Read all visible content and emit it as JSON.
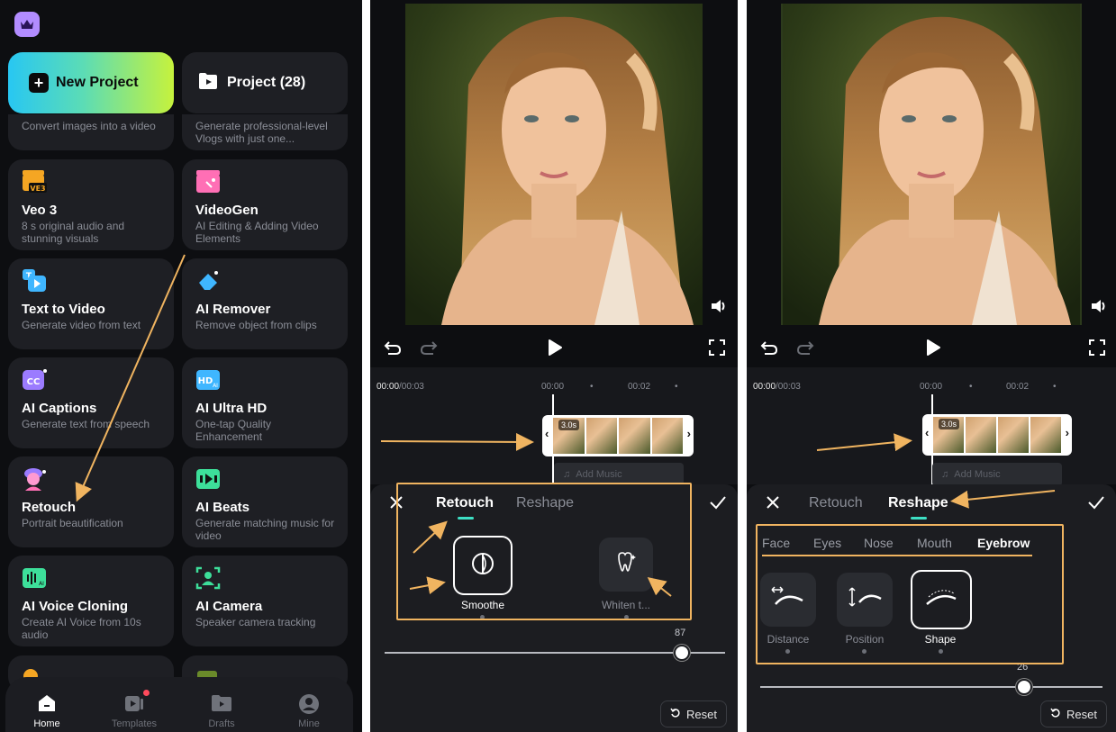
{
  "home": {
    "new_project_label": "New Project",
    "project_label": "Project (28)",
    "partial_cards": [
      {
        "desc": "Convert images into a video"
      },
      {
        "desc": "Generate professional-level Vlogs with just one..."
      }
    ],
    "cards": [
      {
        "title": "Veo 3",
        "desc": "8 s original audio and stunning visuals",
        "icon": "veo3-icon",
        "color": "#f5a623"
      },
      {
        "title": "VideoGen",
        "desc": "AI Editing & Adding Video Elements",
        "icon": "videogen-icon",
        "color": "#ff6fb5"
      },
      {
        "title": "Text to Video",
        "desc": "Generate video from text",
        "icon": "text-to-video-icon",
        "color": "#3fb6ff"
      },
      {
        "title": "AI Remover",
        "desc": "Remove object from clips",
        "icon": "eraser-icon",
        "color": "#3fb6ff"
      },
      {
        "title": "AI Captions",
        "desc": "Generate text from speech",
        "icon": "captions-icon",
        "color": "#9b7bff"
      },
      {
        "title": "AI Ultra HD",
        "desc": "One-tap Quality Enhancement",
        "icon": "hd-icon",
        "color": "#3fb6ff"
      },
      {
        "title": "Retouch",
        "desc": "Portrait beautification",
        "icon": "retouch-icon",
        "color": "#ff6fb5"
      },
      {
        "title": "AI Beats",
        "desc": "Generate matching music for video",
        "icon": "beats-icon",
        "color": "#3ddf9a"
      },
      {
        "title": "AI Voice Cloning",
        "desc": "Create AI Voice from 10s audio",
        "icon": "voice-cloning-icon",
        "color": "#3ddf9a"
      },
      {
        "title": "AI Camera",
        "desc": "Speaker camera tracking",
        "icon": "camera-icon",
        "color": "#3ddf9a"
      }
    ],
    "nav": [
      {
        "label": "Home",
        "icon": "home-icon"
      },
      {
        "label": "Templates",
        "icon": "templates-icon"
      },
      {
        "label": "Drafts",
        "icon": "drafts-icon"
      },
      {
        "label": "Mine",
        "icon": "profile-icon"
      }
    ]
  },
  "editor": {
    "time_current": "00:00",
    "time_total": "/00:03",
    "tick1": "00:00",
    "tick2": "00:02",
    "clip_duration": "3.0s",
    "add_music": "Add Music",
    "reset": "Reset"
  },
  "retouch": {
    "tabs": [
      "Retouch",
      "Reshape"
    ],
    "tools": [
      {
        "label": "Smoothe",
        "icon": "smooth-icon"
      },
      {
        "label": "Whiten t...",
        "icon": "tooth-icon"
      }
    ],
    "slider_value": "87",
    "slider_fraction": 0.87
  },
  "reshape": {
    "tabs": [
      "Retouch",
      "Reshape"
    ],
    "subtabs": [
      "Face",
      "Eyes",
      "Nose",
      "Mouth",
      "Eyebrow"
    ],
    "tools": [
      {
        "label": "Distance",
        "icon": "eyebrow-distance-icon"
      },
      {
        "label": "Position",
        "icon": "eyebrow-position-icon"
      },
      {
        "label": "Shape",
        "icon": "eyebrow-shape-icon"
      }
    ],
    "slider_value": "26"
  },
  "colors": {
    "accent": "#3ddfc4",
    "highlight": "#f0b460",
    "background": "#0d0e11",
    "card": "#1e1f24"
  }
}
